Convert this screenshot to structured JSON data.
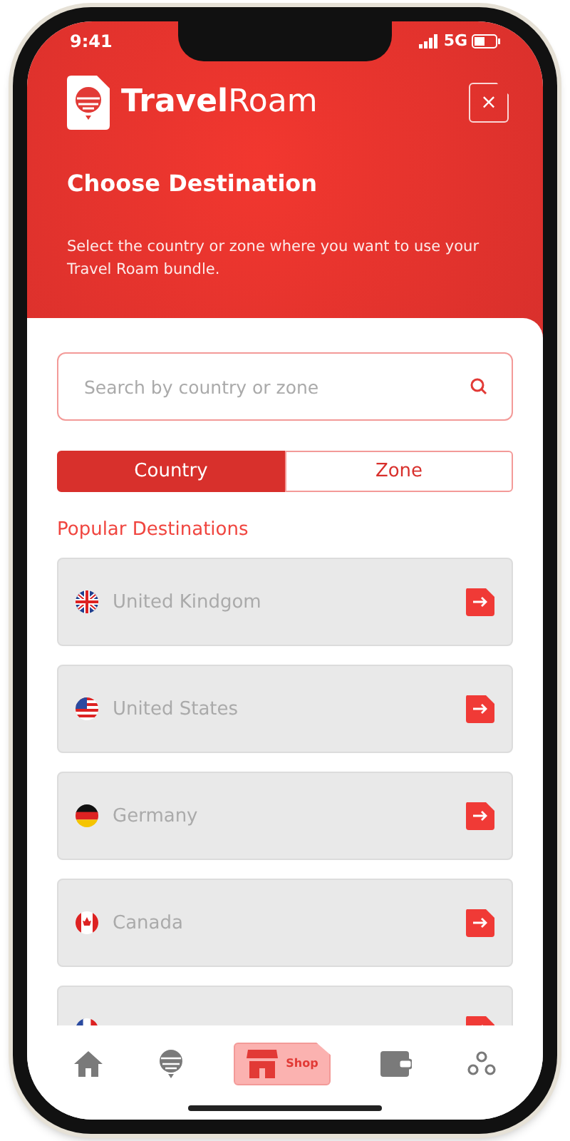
{
  "status_bar": {
    "time": "9:41",
    "network": "5G"
  },
  "header": {
    "brand_bold": "Travel",
    "brand_light": "Roam",
    "close": "×",
    "title": "Choose Destination",
    "subtitle": "Select the country or zone where you want to use your Travel Roam bundle."
  },
  "search": {
    "placeholder": "Search by country or zone"
  },
  "tabs": [
    {
      "label": "Country",
      "selected": true
    },
    {
      "label": "Zone",
      "selected": false
    }
  ],
  "section_title": "Popular Destinations",
  "destinations": [
    {
      "name": "United Kindgom",
      "kind": "uk"
    },
    {
      "name": "United States",
      "kind": "us"
    },
    {
      "name": "Germany",
      "kind": "de"
    },
    {
      "name": "Canada",
      "kind": "ca"
    },
    {
      "kind": "fr"
    }
  ],
  "nav": [
    {
      "kind": "home",
      "selected": false
    },
    {
      "kind": "globe",
      "selected": false
    },
    {
      "kind": "shop",
      "label": "Shop",
      "selected": true
    },
    {
      "kind": "wallet",
      "selected": false
    },
    {
      "kind": "more",
      "selected": false
    }
  ]
}
